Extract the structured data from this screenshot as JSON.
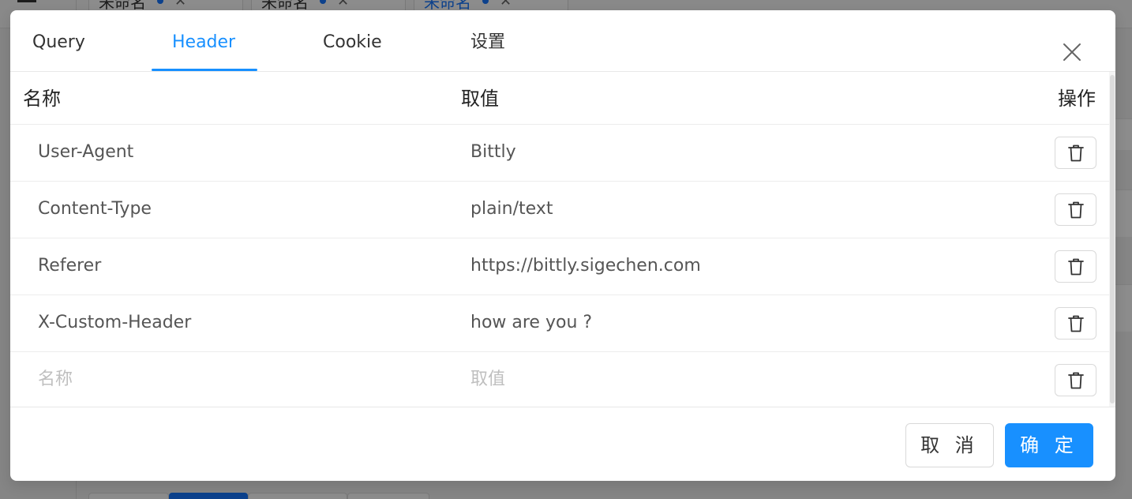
{
  "background": {
    "tabs": [
      {
        "label": "未命名"
      },
      {
        "label": "未命名"
      },
      {
        "label": "未命名"
      }
    ]
  },
  "modal": {
    "tabs": [
      {
        "label": "Query"
      },
      {
        "label": "Header"
      },
      {
        "label": "Cookie"
      },
      {
        "label": "设置"
      }
    ],
    "active_tab": "Header",
    "close_icon": "close-icon",
    "table": {
      "columns": {
        "name": "名称",
        "value": "取值",
        "actions": "操作"
      },
      "rows": [
        {
          "name": "User-Agent",
          "value": "Bittly"
        },
        {
          "name": "Content-Type",
          "value": "plain/text"
        },
        {
          "name": "Referer",
          "value": "https://bittly.sigechen.com"
        },
        {
          "name": "X-Custom-Header",
          "value": "how are you ?"
        }
      ],
      "new_row": {
        "name_placeholder": "名称",
        "value_placeholder": "取值"
      },
      "delete_icon": "trash-icon"
    },
    "footer": {
      "cancel_label": "取 消",
      "ok_label": "确 定"
    }
  },
  "colors": {
    "accent": "#1890ff",
    "placeholder": "#bfbfbf"
  }
}
